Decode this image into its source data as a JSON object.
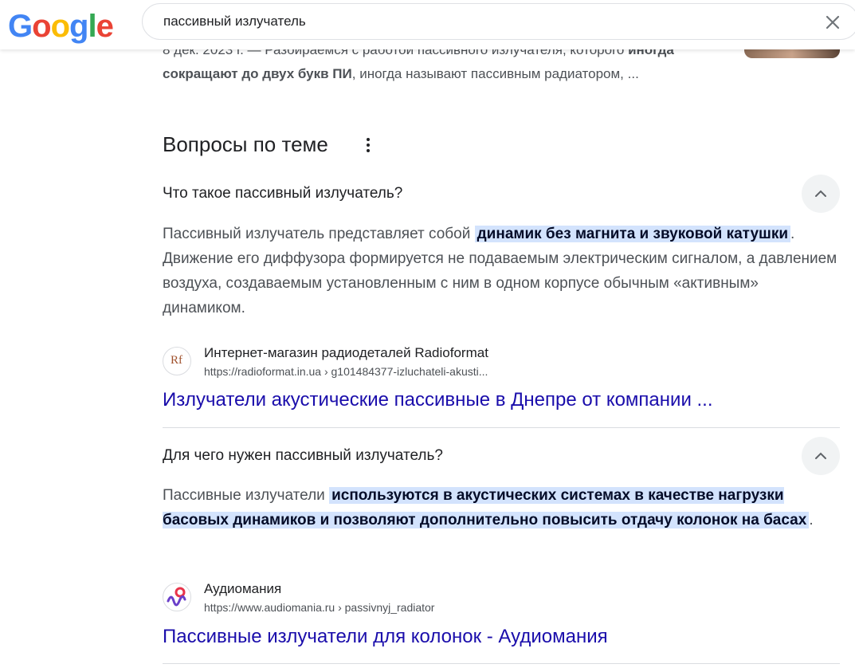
{
  "header": {
    "logo": [
      "G",
      "o",
      "o",
      "g",
      "l",
      "e"
    ],
    "logo_colors": [
      "#4285F4",
      "#EA4335",
      "#FBBC05",
      "#4285F4",
      "#34A853",
      "#EA4335"
    ],
    "search_query": "пассивный излучатель"
  },
  "previous_result": {
    "snippet_prefix": "8 дек. 2023 г. — Разбираемся с работой пассивного излучателя, которого ",
    "snippet_bold_1": "иногда сокращают до двух букв ПИ",
    "snippet_suffix": ", иногда называют пассивным радиатором, ..."
  },
  "paa": {
    "title": "Вопросы по теме",
    "items": [
      {
        "question": "Что такое пассивный излучатель?",
        "answer_before": "Пассивный излучатель представляет собой ",
        "answer_highlight": "динамик без магнита и звуковой катушки",
        "answer_after": ". Движение его диффузора формируется не подаваемым электрическим сигналом, а давлением воздуха, создаваемым установленным с ним в одном корпусе обычным «активным» динамиком.",
        "source_name": "Интернет-магазин радиодеталей Radioformat",
        "source_url": "https://radioformat.in.ua › g101484377-izluchateli-akusti...",
        "favicon_text": "Rf",
        "result_title": "Излучатели акустические пассивные в Днепре от компании ..."
      },
      {
        "question": "Для чего нужен пассивный излучатель?",
        "answer_before": "Пассивные излучатели ",
        "answer_highlight": "используются в акустических системах в качестве нагрузки басовых динамиков и позволяют дополнительно повысить отдачу колонок на басах",
        "answer_after": ".",
        "source_name": "Аудиомания",
        "source_url": "https://www.audiomania.ru › passivnyj_radiator",
        "result_title": "Пассивные излучатели для колонок - Аудиомания"
      }
    ]
  },
  "colors": {
    "link": "#1a0dab",
    "highlight_bg": "#d3e3fd"
  }
}
